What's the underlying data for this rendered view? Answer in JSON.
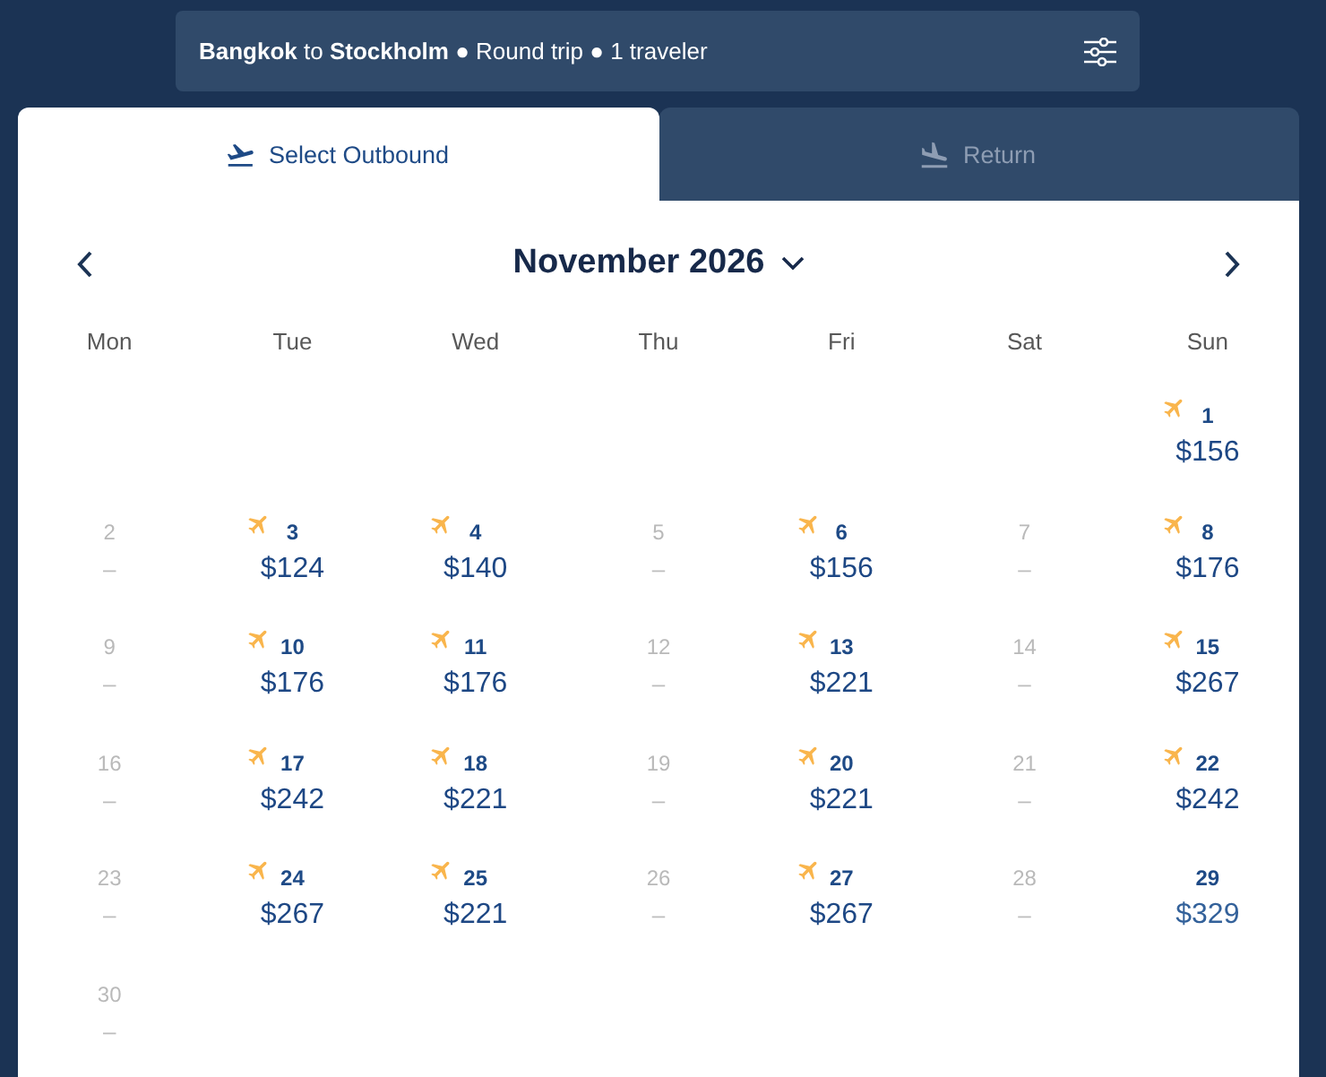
{
  "search_summary": {
    "text": "**Bangkok** to **Stockholm** ● Round trip ● 1 traveler"
  },
  "tabs": [
    {
      "label": "Select Outbound",
      "kind": "outbound",
      "selected": true
    },
    {
      "label": "Return",
      "kind": "return",
      "selected": false
    }
  ],
  "calendar": {
    "month": "November 2026",
    "weekdays": [
      "Mon",
      "Tue",
      "Wed",
      "Thu",
      "Fri",
      "Sat",
      "Sun"
    ],
    "days": [
      {
        "kind": "blank"
      },
      {
        "kind": "blank"
      },
      {
        "kind": "blank"
      },
      {
        "kind": "blank"
      },
      {
        "kind": "blank"
      },
      {
        "kind": "blank"
      },
      {
        "day": "1",
        "price": "$156",
        "kind": "flight"
      },
      {
        "day": "2",
        "price": "–",
        "kind": "none"
      },
      {
        "day": "3",
        "price": "$124",
        "kind": "flight"
      },
      {
        "day": "4",
        "price": "$140",
        "kind": "flight"
      },
      {
        "day": "5",
        "price": "–",
        "kind": "none"
      },
      {
        "day": "6",
        "price": "$156",
        "kind": "flight"
      },
      {
        "day": "7",
        "price": "–",
        "kind": "none"
      },
      {
        "day": "8",
        "price": "$176",
        "kind": "flight"
      },
      {
        "day": "9",
        "price": "–",
        "kind": "none"
      },
      {
        "day": "10",
        "price": "$176",
        "kind": "flight"
      },
      {
        "day": "11",
        "price": "$176",
        "kind": "flight"
      },
      {
        "day": "12",
        "price": "–",
        "kind": "none"
      },
      {
        "day": "13",
        "price": "$221",
        "kind": "flight"
      },
      {
        "day": "14",
        "price": "–",
        "kind": "none"
      },
      {
        "day": "15",
        "price": "$267",
        "kind": "flight"
      },
      {
        "day": "16",
        "price": "–",
        "kind": "none"
      },
      {
        "day": "17",
        "price": "$242",
        "kind": "flight"
      },
      {
        "day": "18",
        "price": "$221",
        "kind": "flight"
      },
      {
        "day": "19",
        "price": "–",
        "kind": "none"
      },
      {
        "day": "20",
        "price": "$221",
        "kind": "flight"
      },
      {
        "day": "21",
        "price": "–",
        "kind": "none"
      },
      {
        "day": "22",
        "price": "$242",
        "kind": "flight"
      },
      {
        "day": "23",
        "price": "–",
        "kind": "none"
      },
      {
        "day": "24",
        "price": "$267",
        "kind": "flight"
      },
      {
        "day": "25",
        "price": "$221",
        "kind": "flight"
      },
      {
        "day": "26",
        "price": "–",
        "kind": "none"
      },
      {
        "day": "27",
        "price": "$267",
        "kind": "flight"
      },
      {
        "day": "28",
        "price": "–",
        "kind": "none"
      },
      {
        "day": "29",
        "price": "$329",
        "kind": "plain"
      },
      {
        "day": "30",
        "price": "–",
        "kind": "none"
      }
    ]
  }
}
